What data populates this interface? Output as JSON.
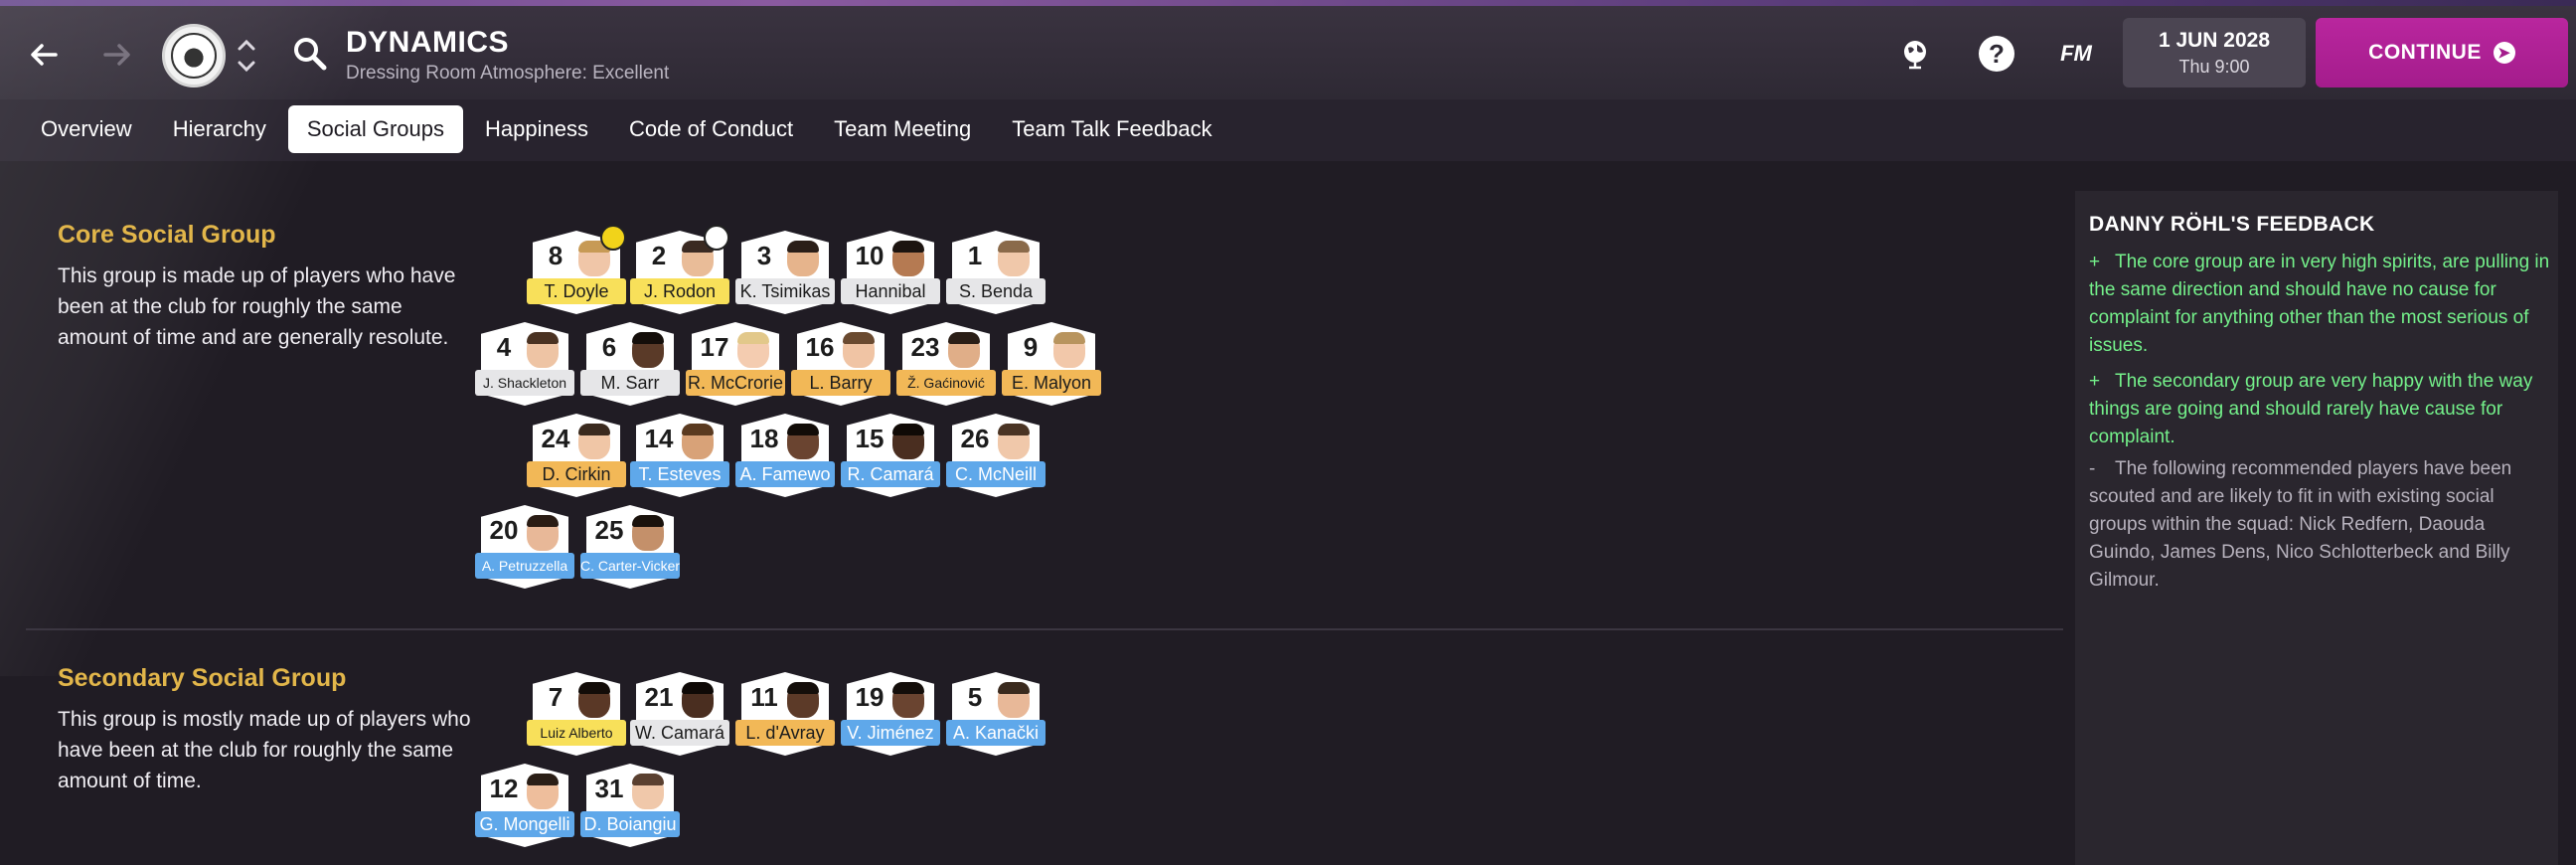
{
  "header": {
    "title": "DYNAMICS",
    "subtitle": "Dressing Room Atmosphere: Excellent",
    "date": "1 JUN 2028",
    "time": "Thu 9:00",
    "continue_label": "CONTINUE",
    "fm_label": "FM",
    "help_label": "?"
  },
  "tabs": [
    {
      "label": "Overview"
    },
    {
      "label": "Hierarchy"
    },
    {
      "label": "Social Groups",
      "active": true
    },
    {
      "label": "Happiness"
    },
    {
      "label": "Code of Conduct"
    },
    {
      "label": "Team Meeting"
    },
    {
      "label": "Team Talk Feedback"
    }
  ],
  "core_group": {
    "title": "Core Social Group",
    "description": "This group is made up of players who have been at the club for roughly the same amount of time and are generally resolute.",
    "players": [
      {
        "number": "8",
        "name": "T. Doyle",
        "tier": "yellow",
        "badge": "captain",
        "skin": "#f0c6a8",
        "hair": "#c79a55"
      },
      {
        "number": "2",
        "name": "J. Rodon",
        "tier": "yellow",
        "badge": "vice",
        "skin": "#e9bc98",
        "hair": "#3a2a22"
      },
      {
        "number": "3",
        "name": "K. Tsimikas",
        "tier": "white",
        "skin": "#e6b48c",
        "hair": "#2a1e18"
      },
      {
        "number": "10",
        "name": "Hannibal",
        "tier": "white",
        "skin": "#b57a52",
        "hair": "#1c1410"
      },
      {
        "number": "1",
        "name": "S. Benda",
        "tier": "white",
        "skin": "#f0c8aa",
        "hair": "#8a6a4a"
      },
      {
        "number": "4",
        "name": "J. Shackleton",
        "tier": "white",
        "skin": "#eec4a4",
        "hair": "#4a3222"
      },
      {
        "number": "6",
        "name": "M. Sarr",
        "tier": "white",
        "skin": "#5a3a28",
        "hair": "#140e0a"
      },
      {
        "number": "17",
        "name": "R. McCrorie",
        "tier": "orange",
        "skin": "#f4ccb0",
        "hair": "#e2c88a"
      },
      {
        "number": "16",
        "name": "L. Barry",
        "tier": "orange",
        "skin": "#f0c4a4",
        "hair": "#6a4a30"
      },
      {
        "number": "23",
        "name": "Ž. Gaćinović",
        "tier": "orange",
        "skin": "#e0ae88",
        "hair": "#2a1e16"
      },
      {
        "number": "9",
        "name": "E. Malyon",
        "tier": "orange",
        "skin": "#f2c8aa",
        "hair": "#b8945e"
      },
      {
        "number": "24",
        "name": "D. Cirkin",
        "tier": "orange",
        "skin": "#f0c6a6",
        "hair": "#3a2a1e"
      },
      {
        "number": "14",
        "name": "T. Esteves",
        "tier": "blue",
        "skin": "#d8a278",
        "hair": "#5a3a20"
      },
      {
        "number": "18",
        "name": "A. Famewo",
        "tier": "blue",
        "skin": "#6a4430",
        "hair": "#120c08"
      },
      {
        "number": "15",
        "name": "R. Camará",
        "tier": "blue",
        "skin": "#4a2e20",
        "hair": "#100a06"
      },
      {
        "number": "26",
        "name": "C. McNeill",
        "tier": "blue",
        "skin": "#f0c8aa",
        "hair": "#4a3424"
      },
      {
        "number": "20",
        "name": "A. Petruzzella",
        "tier": "blue",
        "small": true,
        "skin": "#e8b898",
        "hair": "#2a1c14"
      },
      {
        "number": "25",
        "name": "C. Carter-Vickers",
        "tier": "blue",
        "small": true,
        "skin": "#c4906a",
        "hair": "#1a120c"
      }
    ]
  },
  "secondary_group": {
    "title": "Secondary Social Group",
    "description": "This group is mostly made up of players who have been at the club for roughly the same amount of time.",
    "players": [
      {
        "number": "7",
        "name": "Luiz Alberto",
        "tier": "yellow",
        "skin": "#5a3826",
        "hair": "#120c08"
      },
      {
        "number": "21",
        "name": "W. Camará",
        "tier": "white",
        "skin": "#4a2e20",
        "hair": "#0e0906"
      },
      {
        "number": "11",
        "name": "L. d'Avray",
        "tier": "orange",
        "skin": "#5c3a28",
        "hair": "#140e0a"
      },
      {
        "number": "19",
        "name": "V. Jiménez",
        "tier": "blue",
        "skin": "#6a4430",
        "hair": "#140e0a"
      },
      {
        "number": "5",
        "name": "A. Kanački",
        "tier": "blue",
        "skin": "#e8b898",
        "hair": "#3a2a1e"
      },
      {
        "number": "12",
        "name": "G. Mongelli",
        "tier": "blue",
        "skin": "#eebe9c",
        "hair": "#2a1e16"
      },
      {
        "number": "31",
        "name": "D. Boiangiu",
        "tier": "blue",
        "skin": "#f0c8aa",
        "hair": "#5a4030"
      }
    ]
  },
  "feedback": {
    "title": "DANNY RÖHL'S FEEDBACK",
    "items": [
      {
        "mark": "+",
        "type": "pos",
        "text": "The core group are in very high spirits, are pulling in the same direction and should have no cause for complaint for anything other than the most serious of issues."
      },
      {
        "mark": "+",
        "type": "pos",
        "text": "The secondary group are very happy with the way things are going and should rarely have cause for complaint."
      },
      {
        "mark": "-",
        "type": "neu",
        "text": "The following recommended players have been scouted and are likely to fit in with existing social groups within the squad: Nick Redfern, Daouda Guindo, James Dens, Nico Schlotterbeck and Billy Gilmour."
      }
    ]
  }
}
